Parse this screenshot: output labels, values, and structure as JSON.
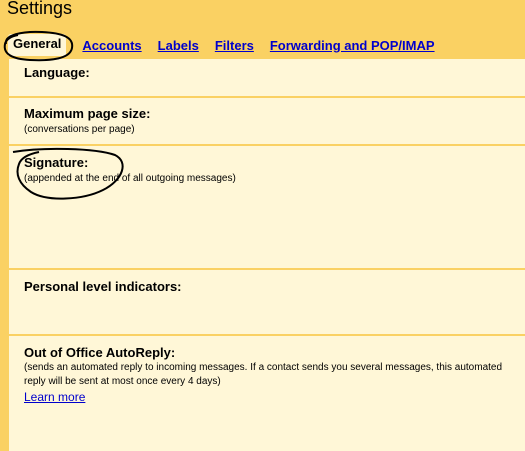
{
  "page": {
    "title": "Settings"
  },
  "tabs": [
    {
      "label": "General",
      "active": true
    },
    {
      "label": "Accounts"
    },
    {
      "label": "Labels"
    },
    {
      "label": "Filters"
    },
    {
      "label": "Forwarding and POP/IMAP"
    }
  ],
  "settings": {
    "language": {
      "label": "Language:"
    },
    "page_size": {
      "label": "Maximum page size:",
      "desc": "(conversations per page)"
    },
    "signature": {
      "label": "Signature:",
      "desc": "(appended at the end of all outgoing messages)"
    },
    "level_indicators": {
      "label": "Personal level indicators:"
    },
    "autoreply": {
      "label": "Out of Office AutoReply:",
      "desc_line1": "(sends an automated reply to incoming messages. If a contact sends you several messages, this automated",
      "desc_line2": "reply will be sent at most once every 4 days)",
      "link": "Learn more"
    }
  },
  "colors": {
    "background": "#fad163",
    "panel": "#fff7d7",
    "link": "#0000cc",
    "annotation": "#000000"
  }
}
